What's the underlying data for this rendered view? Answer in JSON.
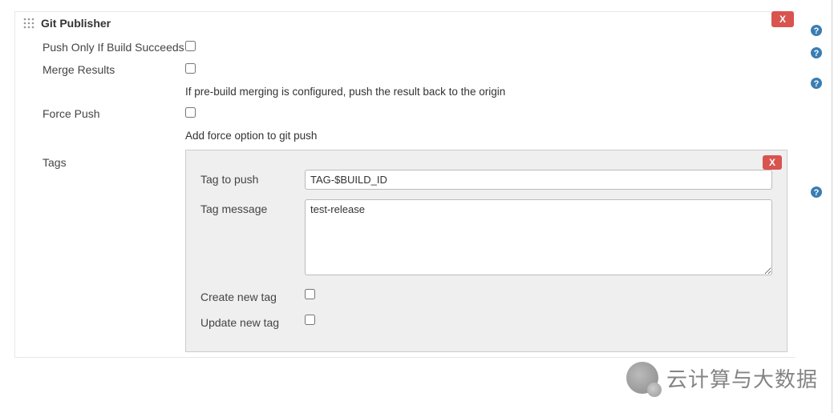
{
  "section": {
    "title": "Git Publisher"
  },
  "options": {
    "push_only_label": "Push Only If Build Succeeds",
    "push_only_checked": false,
    "merge_results_label": "Merge Results",
    "merge_results_checked": false,
    "merge_results_help": "If pre-build merging is configured, push the result back to the origin",
    "force_push_label": "Force Push",
    "force_push_checked": false,
    "force_push_help": "Add force option to git push",
    "tags_label": "Tags"
  },
  "tags": {
    "tag_to_push_label": "Tag to push",
    "tag_to_push_value": "TAG-$BUILD_ID",
    "tag_message_label": "Tag message",
    "tag_message_value": "test-release",
    "create_new_tag_label": "Create new tag",
    "create_new_tag_checked": false,
    "update_new_tag_label": "Update new tag",
    "update_new_tag_checked": false
  },
  "buttons": {
    "delete_outer": "X",
    "delete_tags": "X"
  },
  "watermark": {
    "text": "云计算与大数据"
  }
}
